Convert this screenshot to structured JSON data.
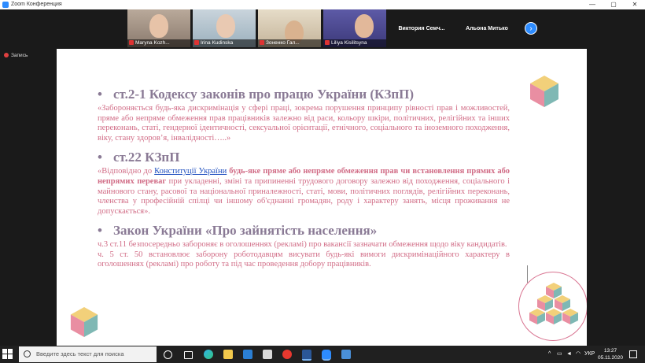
{
  "window": {
    "title": "Zoom Конференция",
    "minimize": "—",
    "maximize": "▢",
    "close": "✕"
  },
  "participants": [
    {
      "name": "Maryna Kozh..."
    },
    {
      "name": "Irina Kudinska"
    },
    {
      "name": "Зоненко Гал..."
    },
    {
      "name": "Liliya Kisilitsyna"
    }
  ],
  "name_tiles": [
    "Виктория Семч...",
    "Альона Митько"
  ],
  "next_arrow": "›",
  "recording": "Запись",
  "slide": {
    "s1": {
      "bullet": "•",
      "heading": "ст.2-1 Кодексу законів про працю України (КЗпП)",
      "text": "«Забороняється будь-яка дискримінація у сфері праці, зокрема порушення принципу рівності прав і можливостей, пряме або непряме обмеження прав працівників залежно від раси, кольору шкіри, політичних, релігійних та інших переконань, статі, гендерної ідентичності, сексуальної орієнтації, етнічного, соціального та іноземного походження, віку, стану здоров’я, інвалідності…..»"
    },
    "s2": {
      "bullet": "•",
      "heading": "ст.22 КЗпП",
      "pre": "«Відповідно до ",
      "link": "Конституції України",
      "bold": " будь-яке пряме або непряме обмеження прав чи встановлення прямих або непрямих переваг",
      "post": " при укладенні, зміні та припиненні трудового договору залежно від походження, соціального і майнового стану, расової та національної приналежності, статі, мови, політичних поглядів, релігійних переконань, членства у професійній спілці чи іншому об'єднанні громадян, роду і характеру занять, місця проживання не допускається»."
    },
    "s3": {
      "bullet": "•",
      "heading": "Закон України «Про зайнятість населення»",
      "text1": "ч.3 ст.11 безпосередньо забороняє в оголошеннях (рекламі) про вакансії зазначати обмеження щодо віку кандидатів.",
      "text2": "ч. 5 ст. 50 встановлює заборону роботодавцям висувати будь-які вимоги дискримінаційного характеру в оголошеннях (рекламі) про роботу та під час проведення добору працівників."
    }
  },
  "taskbar": {
    "search_placeholder": "Введите здесь текст для поиска",
    "language": "УКР",
    "tray_chevron": "^",
    "time": "13:27",
    "date": "05.11.2020"
  },
  "colors": {
    "cube_pink": "#e98ea2",
    "cube_yellow": "#f2d07a",
    "cube_teal": "#7fb8b4",
    "heading": "#8a7a95",
    "body_text": "#d16c86"
  }
}
